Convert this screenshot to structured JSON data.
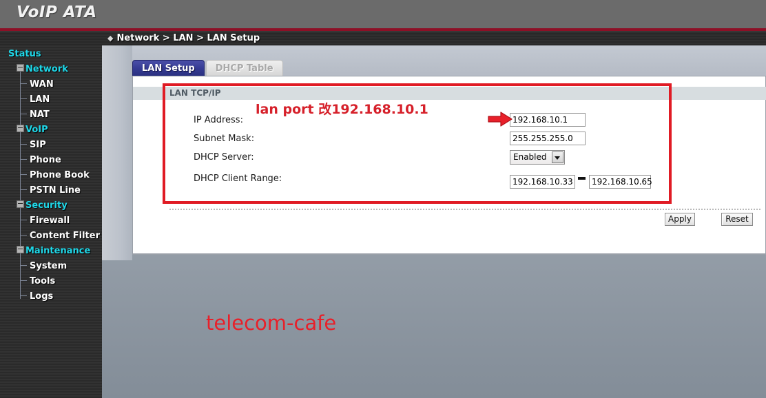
{
  "header": {
    "brand": "VoIP ATA"
  },
  "breadcrumb": {
    "bullet": "◆",
    "text": "Network > LAN > LAN Setup"
  },
  "sidebar": {
    "items": [
      {
        "label": "Status",
        "level": 0,
        "expander": false
      },
      {
        "label": "Network",
        "level": 1,
        "expander": true
      },
      {
        "label": "WAN",
        "level": 2,
        "expander": false
      },
      {
        "label": "LAN",
        "level": 2,
        "expander": false
      },
      {
        "label": "NAT",
        "level": 2,
        "expander": false
      },
      {
        "label": "VoIP",
        "level": 1,
        "expander": true
      },
      {
        "label": "SIP",
        "level": 2,
        "expander": false
      },
      {
        "label": "Phone",
        "level": 2,
        "expander": false
      },
      {
        "label": "Phone Book",
        "level": 2,
        "expander": false
      },
      {
        "label": "PSTN Line",
        "level": 2,
        "expander": false
      },
      {
        "label": "Security",
        "level": 1,
        "expander": true
      },
      {
        "label": "Firewall",
        "level": 2,
        "expander": false
      },
      {
        "label": "Content Filter",
        "level": 2,
        "expander": false
      },
      {
        "label": "Maintenance",
        "level": 1,
        "expander": true
      },
      {
        "label": "System",
        "level": 2,
        "expander": false
      },
      {
        "label": "Tools",
        "level": 2,
        "expander": false
      },
      {
        "label": "Logs",
        "level": 2,
        "expander": false
      }
    ]
  },
  "tabs": [
    {
      "label": "LAN Setup",
      "active": true
    },
    {
      "label": "DHCP Table",
      "active": false
    }
  ],
  "panel": {
    "section_title": "LAN TCP/IP",
    "fields": {
      "ip_address_label": "IP Address:",
      "ip_address_value": "192.168.10.1",
      "subnet_mask_label": "Subnet Mask:",
      "subnet_mask_value": "255.255.255.0",
      "dhcp_server_label": "DHCP Server:",
      "dhcp_server_value": "Enabled",
      "dhcp_range_label": "DHCP Client Range:",
      "dhcp_range_start": "192.168.10.33",
      "dhcp_range_end": "192.168.10.65",
      "range_separator": "-"
    },
    "buttons": {
      "apply": "Apply",
      "reset": "Reset"
    }
  },
  "annotations": {
    "note_text": "lan port 改192.168.10.1",
    "watermark": "telecom-cafe",
    "accent_red": "#e01b24",
    "note_red": "#d6202a"
  }
}
